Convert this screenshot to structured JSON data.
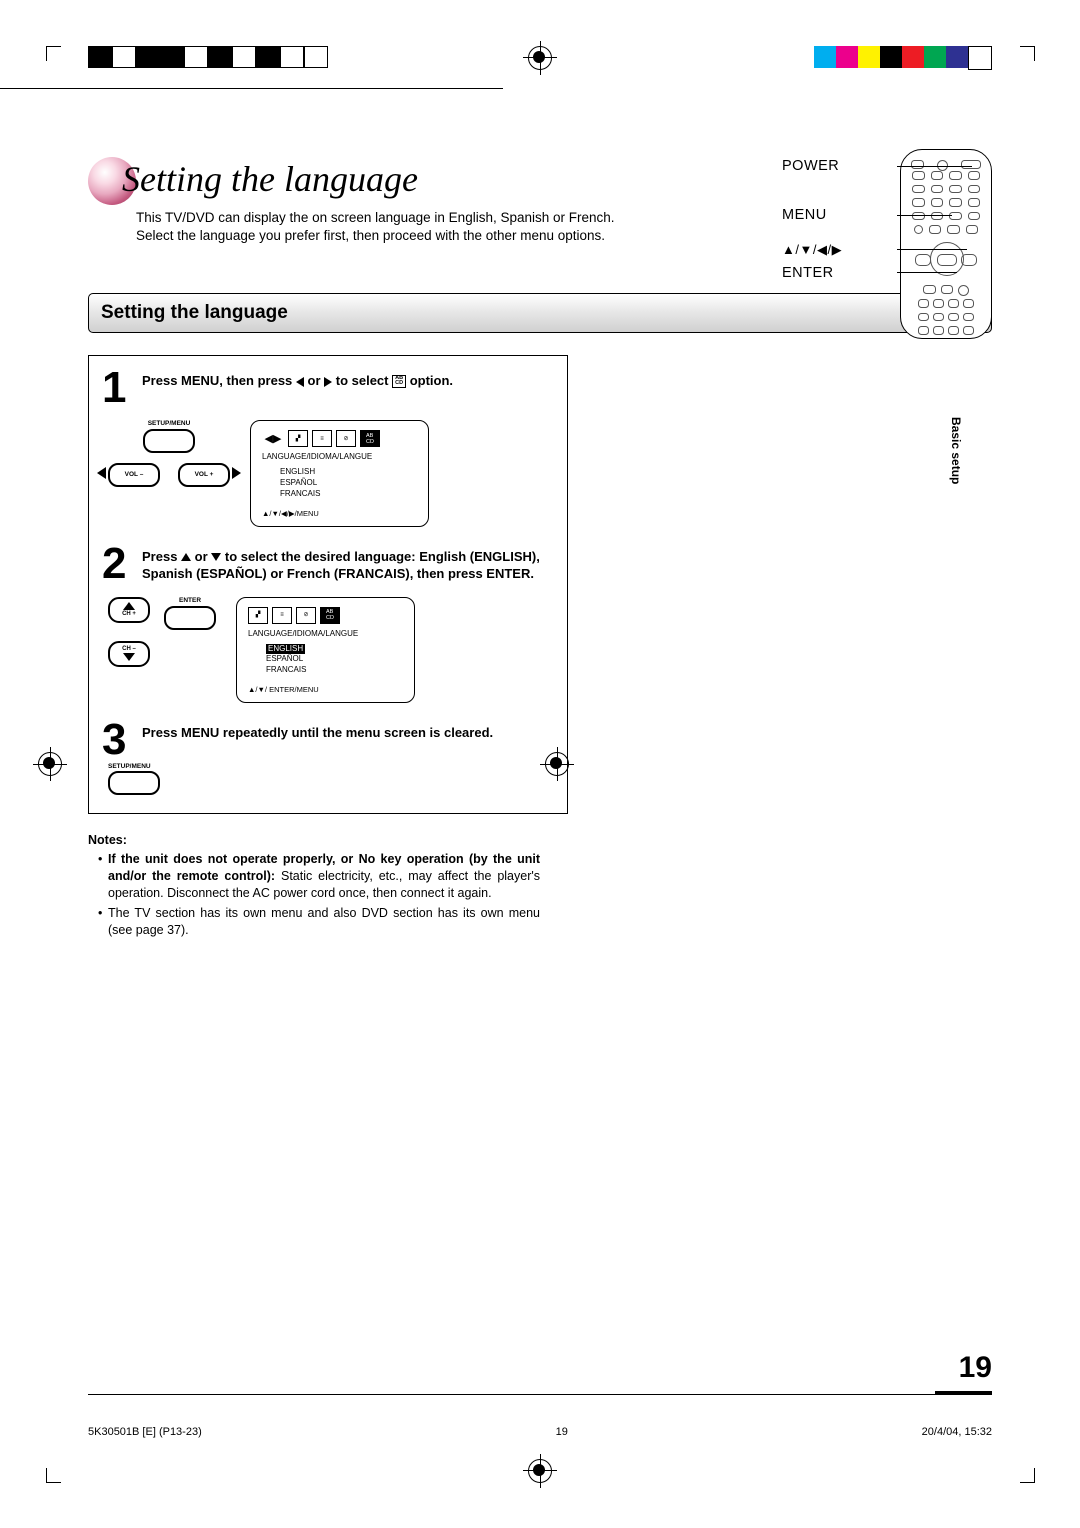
{
  "title": "Setting the language",
  "intro": "This TV/DVD can display the on screen language in English, Spanish or French. Select the language you prefer first, then proceed with the other menu options.",
  "remote_labels": {
    "power": "POWER",
    "menu": "MENU",
    "arrows": "▲/▼/◀/▶",
    "enter": "ENTER"
  },
  "section_heading": "Setting the language",
  "side_tab": "Basic setup",
  "steps": {
    "s1": {
      "num": "1",
      "text_a": "Press MENU, then press ",
      "text_b": " or ",
      "text_c": " to select ",
      "text_d": " option."
    },
    "s2": {
      "num": "2",
      "text_a": "Press ",
      "text_b": " or ",
      "text_c": " to select the desired language: English (ENGLISH), Spanish (ESPAÑOL) or French (FRANCAIS), then press ENTER."
    },
    "s3": {
      "num": "3",
      "text": "Press MENU repeatedly until the menu screen is cleared."
    }
  },
  "remote_buttons": {
    "setup_menu": "SETUP/MENU",
    "vol_minus": "VOL –",
    "vol_plus": "VOL +",
    "ch_plus": "CH +",
    "ch_minus": "CH –",
    "enter": "ENTER"
  },
  "osd": {
    "title": "LANGUAGE/IDIOMA/LANGUE",
    "opts": {
      "en": "ENGLISH",
      "es": "ESPAÑOL",
      "fr": "FRANCAIS"
    },
    "foot1": "▲/▼/◀/▶/MENU",
    "foot2": "▲/▼/ ENTER/MENU",
    "icon_ab": "AB\nCD"
  },
  "notes": {
    "heading": "Notes:",
    "n1_a": "If the unit does not operate properly, or No key operation (by the unit and/or the remote control):",
    "n1_b": " Static electricity, etc., may affect the player's operation. Disconnect the AC power cord once, then connect it again.",
    "n2": "The TV section has its own menu and also DVD section has its own menu (see page 37)."
  },
  "page_number": "19",
  "footer": {
    "left": "5K30501B [E] (P13-23)",
    "center": "19",
    "right": "20/4/04, 15:32"
  },
  "colors": [
    "#00aeef",
    "#ec008c",
    "#fff200",
    "#000000",
    "#ed1c24",
    "#00a651",
    "#2e3192",
    "#ffffff"
  ]
}
